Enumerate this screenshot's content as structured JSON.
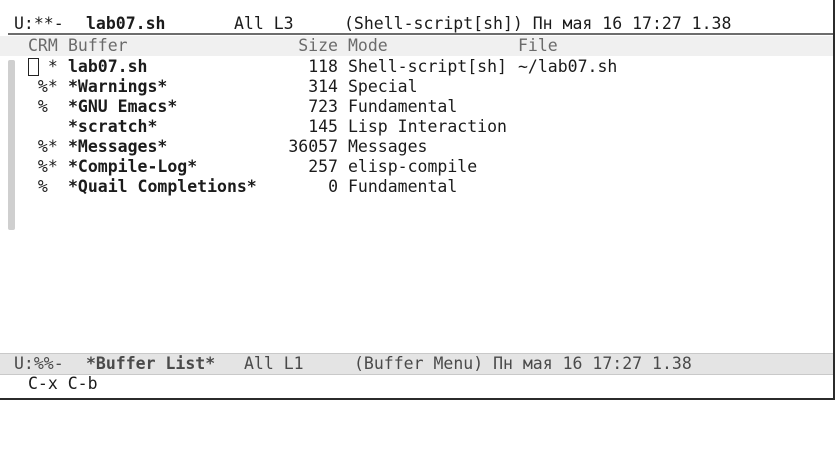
{
  "top_modeline": {
    "status": "U:**-",
    "buffer_name": "lab07.sh",
    "position": "All L3",
    "mode_and_time": "(Shell-script[sh]) Пн мая 16 17:27 1.38"
  },
  "buffer_menu": {
    "columns": {
      "crm": "CRM",
      "buffer": "Buffer",
      "size": "Size",
      "mode": "Mode",
      "file": "File"
    },
    "rows": [
      {
        "flags": "  *",
        "name": "lab07.sh",
        "size": "118",
        "mode": "Shell-script[sh]",
        "file": "~/lab07.sh"
      },
      {
        "flags": " %*",
        "name": "*Warnings*",
        "size": "314",
        "mode": "Special",
        "file": ""
      },
      {
        "flags": " %",
        "name": "*GNU Emacs*",
        "size": "723",
        "mode": "Fundamental",
        "file": ""
      },
      {
        "flags": "",
        "name": "*scratch*",
        "size": "145",
        "mode": "Lisp Interaction",
        "file": ""
      },
      {
        "flags": " %*",
        "name": "*Messages*",
        "size": "36057",
        "mode": "Messages",
        "file": ""
      },
      {
        "flags": " %*",
        "name": "*Compile-Log*",
        "size": "257",
        "mode": "elisp-compile",
        "file": ""
      },
      {
        "flags": " %",
        "name": "*Quail Completions*",
        "size": "0",
        "mode": "Fundamental",
        "file": ""
      }
    ]
  },
  "bottom_modeline": {
    "status": "U:%%-",
    "buffer_name": "*Buffer List*",
    "position": "All L1",
    "mode_and_time": "(Buffer Menu) Пн мая 16 17:27 1.38"
  },
  "echo_area": {
    "text": "C-x C-b"
  }
}
